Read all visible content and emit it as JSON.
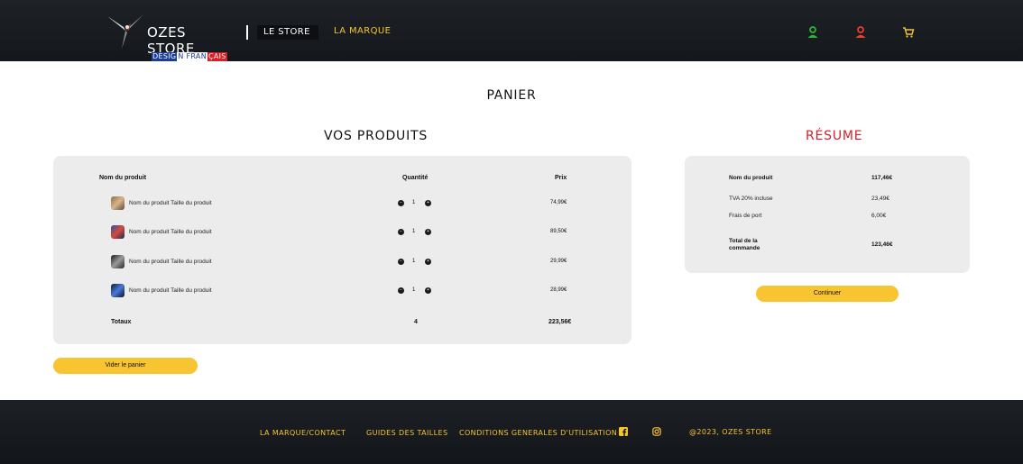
{
  "header": {
    "logo_text": "OZES STORE",
    "logo_sub_1": "DESIG",
    "logo_sub_2": "N FRAN",
    "logo_sub_3": "ÇAIS",
    "nav_store": "LE STORE",
    "nav_marque": "LA MARQUE"
  },
  "page": {
    "title": "PANIER"
  },
  "products": {
    "title": "VOS PRODUITS",
    "col_name": "Nom du produit",
    "col_qty": "Quantité",
    "col_price": "Prix",
    "rows": [
      {
        "name": "Nom du produit Taille du produit",
        "qty": "1",
        "price": "74,99€"
      },
      {
        "name": "Nom du produit Taille du produit",
        "qty": "1",
        "price": "89,50€"
      },
      {
        "name": "Nom du produit Taille du produit",
        "qty": "1",
        "price": "29,99€"
      },
      {
        "name": "Nom du produit Taille du produit",
        "qty": "1",
        "price": "28,99€"
      }
    ],
    "totals_label": "Totaux",
    "totals_qty": "4",
    "totals_price": "223,56€",
    "clear_button": "Vider le panier"
  },
  "summary": {
    "title": "RÉSUME",
    "product_label": "Nom du produit",
    "product_value": "117,46€",
    "tva_label": "TVA 20% incluse",
    "tva_value": "23,49€",
    "shipping_label": "Frais de port",
    "shipping_value": "6,00€",
    "total_label_1": "Total de la",
    "total_label_2": "commande",
    "total_value": "123,46€",
    "continue_button": "Continuer"
  },
  "footer": {
    "link_marque": "LA MARQUE/CONTACT",
    "link_guides": "GUIDES DES TAILLES",
    "link_cgu": "CONDITIONS GENERALES D'UTILISATION",
    "copyright": "@2023, OZES STORE"
  },
  "colors": {
    "accent": "#f8c431",
    "resume_red": "#d0202a",
    "header_bg": "#1a1d21"
  },
  "icons": [
    "user-green-icon",
    "user-red-icon",
    "cart-icon",
    "facebook-icon",
    "instagram-icon",
    "minus-icon",
    "plus-icon"
  ]
}
